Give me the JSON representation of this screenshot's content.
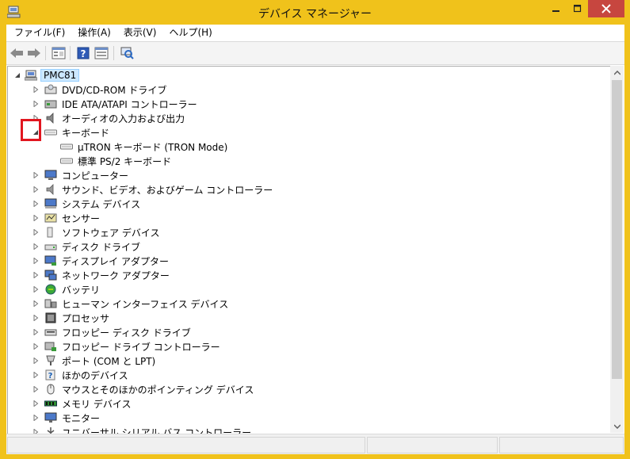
{
  "window": {
    "title": "デバイス マネージャー"
  },
  "menu": [
    "ファイル(F)",
    "操作(A)",
    "表示(V)",
    "ヘルプ(H)"
  ],
  "toolbar": {
    "buttons": [
      "back-arrow-icon",
      "forward-arrow-icon",
      "properties-icon",
      "help-icon",
      "show-hidden-icon",
      "scan-hardware-icon"
    ]
  },
  "tree": {
    "root": "PMC81",
    "categories": [
      {
        "label": "DVD/CD-ROM ドライブ",
        "icon": "optical-drive-icon",
        "expanded": false
      },
      {
        "label": "IDE ATA/ATAPI コントローラー",
        "icon": "ide-controller-icon",
        "expanded": false
      },
      {
        "label": "オーディオの入力および出力",
        "icon": "speaker-icon",
        "expanded": false
      },
      {
        "label": "キーボード",
        "icon": "keyboard-icon",
        "expanded": true,
        "children": [
          "μTRON キーボード (TRON Mode)",
          "標準 PS/2 キーボード"
        ]
      },
      {
        "label": "コンピューター",
        "icon": "computer-icon",
        "expanded": false
      },
      {
        "label": "サウンド、ビデオ、およびゲーム コントローラー",
        "icon": "sound-icon",
        "expanded": false
      },
      {
        "label": "システム デバイス",
        "icon": "system-device-icon",
        "expanded": false
      },
      {
        "label": "センサー",
        "icon": "sensor-icon",
        "expanded": false
      },
      {
        "label": "ソフトウェア デバイス",
        "icon": "software-device-icon",
        "expanded": false
      },
      {
        "label": "ディスク ドライブ",
        "icon": "disk-drive-icon",
        "expanded": false
      },
      {
        "label": "ディスプレイ アダプター",
        "icon": "display-adapter-icon",
        "expanded": false
      },
      {
        "label": "ネットワーク アダプター",
        "icon": "network-adapter-icon",
        "expanded": false
      },
      {
        "label": "バッテリ",
        "icon": "battery-icon",
        "expanded": false
      },
      {
        "label": "ヒューマン インターフェイス デバイス",
        "icon": "hid-icon",
        "expanded": false
      },
      {
        "label": "プロセッサ",
        "icon": "processor-icon",
        "expanded": false
      },
      {
        "label": "フロッピー ディスク ドライブ",
        "icon": "floppy-drive-icon",
        "expanded": false
      },
      {
        "label": "フロッピー ドライブ コントローラー",
        "icon": "floppy-controller-icon",
        "expanded": false
      },
      {
        "label": "ポート (COM と LPT)",
        "icon": "port-icon",
        "expanded": false
      },
      {
        "label": "ほかのデバイス",
        "icon": "other-device-icon",
        "expanded": false
      },
      {
        "label": "マウスとそのほかのポインティング デバイス",
        "icon": "mouse-icon",
        "expanded": false
      },
      {
        "label": "メモリ デバイス",
        "icon": "memory-icon",
        "expanded": false
      },
      {
        "label": "モニター",
        "icon": "monitor-icon",
        "expanded": false
      },
      {
        "label": "ユニバーサル シリアル バス コントローラー",
        "icon": "usb-controller-icon",
        "expanded": false
      }
    ]
  },
  "colors": {
    "titlebar": "#f0c21b",
    "close_button": "#c7463f",
    "highlight_box": "#e1161f",
    "selection": "#cce8ff"
  }
}
